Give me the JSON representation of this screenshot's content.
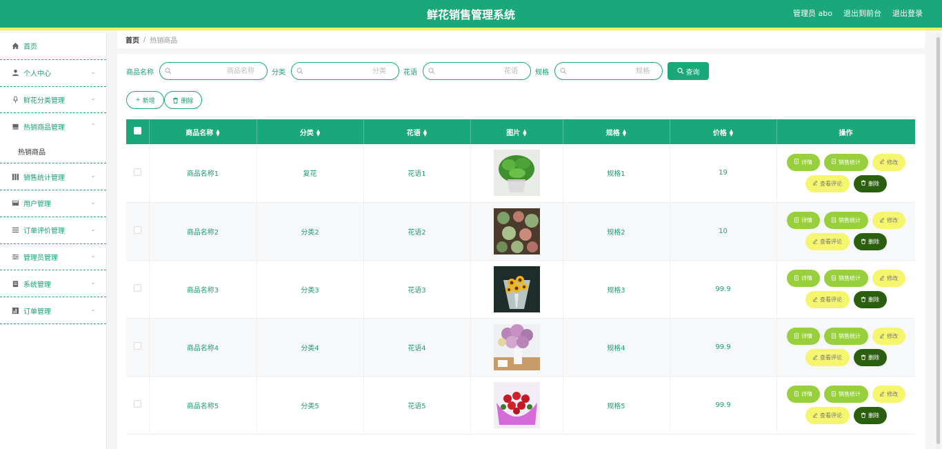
{
  "header": {
    "title": "鲜花销售管理系统",
    "admin_label": "管理员 abo",
    "to_front": "退出到前台",
    "logout": "退出登录"
  },
  "sidebar": {
    "items": [
      {
        "label": "首页",
        "icon": "home-icon",
        "expanded": false,
        "has_chevron": false
      },
      {
        "label": "个人中心",
        "icon": "user-icon",
        "has_chevron": true
      },
      {
        "label": "鲜花分类管理",
        "icon": "microphone-icon",
        "has_chevron": true
      },
      {
        "label": "热销商品管理",
        "icon": "box-icon",
        "has_chevron": true,
        "expanded": true,
        "sub": [
          "热销商品"
        ]
      },
      {
        "label": "销售统计管理",
        "icon": "grid-icon",
        "has_chevron": true
      },
      {
        "label": "用户管理",
        "icon": "card-icon",
        "has_chevron": true
      },
      {
        "label": "订单评价管理",
        "icon": "list-icon",
        "has_chevron": true
      },
      {
        "label": "管理员管理",
        "icon": "sliders-icon",
        "has_chevron": true
      },
      {
        "label": "系统管理",
        "icon": "clipboard-icon",
        "has_chevron": true
      },
      {
        "label": "订单管理",
        "icon": "chart-icon",
        "has_chevron": true
      }
    ]
  },
  "breadcrumb": {
    "home": "首页",
    "sep": "/",
    "current": "热销商品"
  },
  "search": {
    "name_label": "商品名称",
    "name_placeholder": "商品名称",
    "category_label": "分类",
    "category_placeholder": "分类",
    "flower_label": "花语",
    "flower_placeholder": "花语",
    "spec_label": "规格",
    "spec_placeholder": "规格",
    "query_button": "查询"
  },
  "actions": {
    "add": "新增",
    "delete": "删除"
  },
  "table": {
    "columns": [
      "商品名称",
      "分类",
      "花语",
      "图片",
      "规格",
      "价格",
      "操作"
    ],
    "ops": {
      "detail": "详情",
      "stat": "销售统计",
      "edit": "修改",
      "review": "查看评论",
      "delete": "删除"
    },
    "rows": [
      {
        "name": "商品名称1",
        "category": "复花",
        "flower": "花语1",
        "spec": "规格1",
        "price": "19",
        "image": "green-potted-plant"
      },
      {
        "name": "商品名称2",
        "category": "分类2",
        "flower": "花语2",
        "spec": "规格2",
        "price": "10",
        "image": "succulent-arrangement"
      },
      {
        "name": "商品名称3",
        "category": "分类3",
        "flower": "花语3",
        "spec": "规格3",
        "price": "99.9",
        "image": "sunflower-bouquet"
      },
      {
        "name": "商品名称4",
        "category": "分类4",
        "flower": "花语4",
        "spec": "规格4",
        "price": "99.9",
        "image": "gypsophila-vase"
      },
      {
        "name": "商品名称5",
        "category": "分类5",
        "flower": "花语5",
        "spec": "规格5",
        "price": "99.9",
        "image": "red-rose-bouquet"
      }
    ]
  },
  "colors": {
    "primary": "#1aa77a",
    "accent_bar": "#eaf55b",
    "detail_btn": "#98cf3c",
    "edit_btn": "#f6f56e",
    "delete_btn": "#2b5f0f"
  }
}
